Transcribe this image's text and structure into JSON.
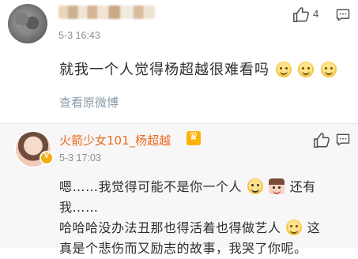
{
  "comments": [
    {
      "time": "5-3 16:43",
      "likes": "4",
      "text_prefix": "就我一个人觉得杨超越很难看吗",
      "emoji_names": [
        "grin-emoji",
        "grin-emoji",
        "grin-emoji"
      ],
      "action_text": "查看原微博"
    },
    {
      "username": "火箭少女101_杨超越",
      "time": "5-3 17:03",
      "line1_part1": "嗯……我觉得可能不是你一个人",
      "line1_part2": "还有我……",
      "line2_part1": "哈哈哈没办法丑那也得活着也得做艺人",
      "line2_part2": "这",
      "line3": "真是个悲伤而又励志的故事，我哭了你呢。"
    }
  ],
  "colors": {
    "username_orange": "#e96b20",
    "link_gray_blue": "#8a9aa7",
    "meta_gray": "#8f8f8f",
    "reply_background": "#f7f7f7"
  },
  "icons": {
    "like": "thumb-up-icon",
    "comment": "message-icon",
    "verified": "verified-badge-icon",
    "crown": "crown-icon"
  }
}
